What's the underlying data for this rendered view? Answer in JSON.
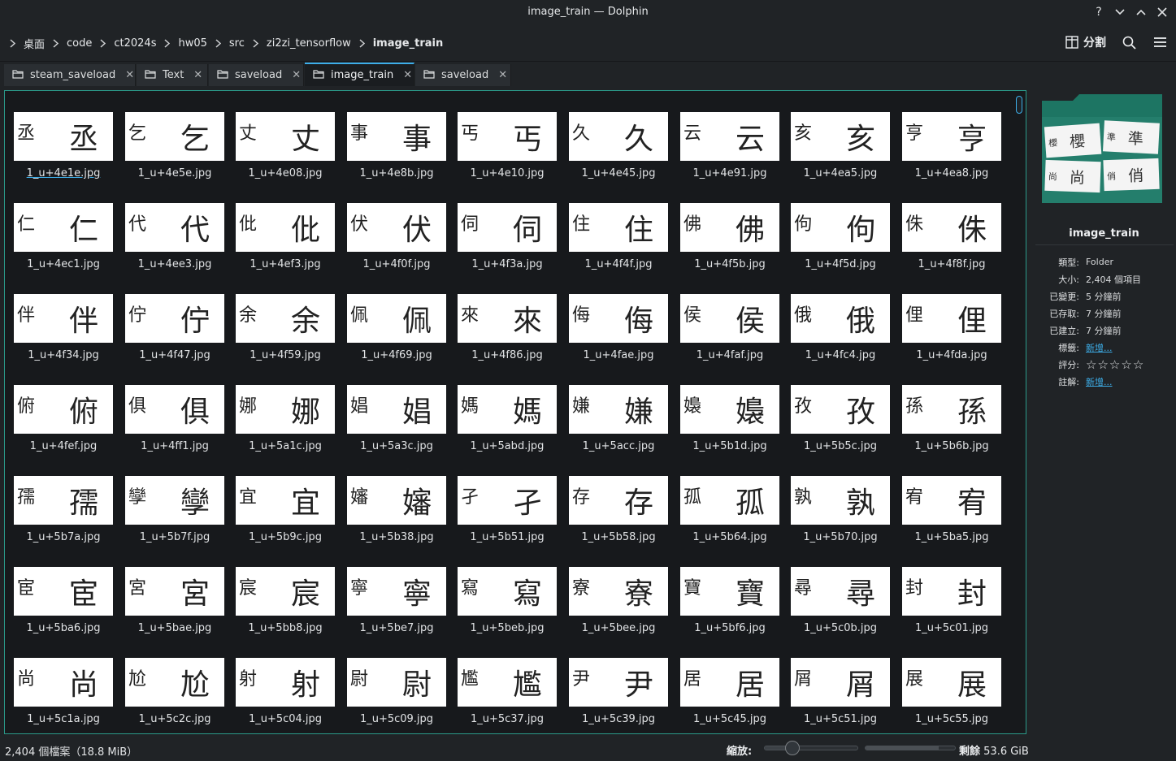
{
  "window": {
    "title": "image_train — Dolphin"
  },
  "toolbar": {
    "breadcrumbs": [
      "桌面",
      "code",
      "ct2024s",
      "hw05",
      "src",
      "zi2zi_tensorflow",
      "image_train"
    ],
    "split_label": "分割"
  },
  "tabs": [
    {
      "label": "steam_saveload"
    },
    {
      "label": "Text"
    },
    {
      "label": "saveload"
    },
    {
      "label": "image_train",
      "active": true
    },
    {
      "label": "saveload"
    }
  ],
  "files": [
    {
      "name": "1_u+4e1e.jpg",
      "char": "丞"
    },
    {
      "name": "1_u+4e5e.jpg",
      "char": "乞"
    },
    {
      "name": "1_u+4e08.jpg",
      "char": "丈"
    },
    {
      "name": "1_u+4e8b.jpg",
      "char": "事"
    },
    {
      "name": "1_u+4e10.jpg",
      "char": "丐"
    },
    {
      "name": "1_u+4e45.jpg",
      "char": "久"
    },
    {
      "name": "1_u+4e91.jpg",
      "char": "云"
    },
    {
      "name": "1_u+4ea5.jpg",
      "char": "亥"
    },
    {
      "name": "1_u+4ea8.jpg",
      "char": "亨"
    },
    {
      "name": "1_u+4ec1.jpg",
      "char": "仁"
    },
    {
      "name": "1_u+4ee3.jpg",
      "char": "代"
    },
    {
      "name": "1_u+4ef3.jpg",
      "char": "仳"
    },
    {
      "name": "1_u+4f0f.jpg",
      "char": "伏"
    },
    {
      "name": "1_u+4f3a.jpg",
      "char": "伺"
    },
    {
      "name": "1_u+4f4f.jpg",
      "char": "住"
    },
    {
      "name": "1_u+4f5b.jpg",
      "char": "佛"
    },
    {
      "name": "1_u+4f5d.jpg",
      "char": "佝"
    },
    {
      "name": "1_u+4f8f.jpg",
      "char": "侏"
    },
    {
      "name": "1_u+4f34.jpg",
      "char": "伴"
    },
    {
      "name": "1_u+4f47.jpg",
      "char": "佇"
    },
    {
      "name": "1_u+4f59.jpg",
      "char": "余"
    },
    {
      "name": "1_u+4f69.jpg",
      "char": "佩"
    },
    {
      "name": "1_u+4f86.jpg",
      "char": "來"
    },
    {
      "name": "1_u+4fae.jpg",
      "char": "侮"
    },
    {
      "name": "1_u+4faf.jpg",
      "char": "侯"
    },
    {
      "name": "1_u+4fc4.jpg",
      "char": "俄"
    },
    {
      "name": "1_u+4fda.jpg",
      "char": "俚"
    },
    {
      "name": "1_u+4fef.jpg",
      "char": "俯"
    },
    {
      "name": "1_u+4ff1.jpg",
      "char": "俱"
    },
    {
      "name": "1_u+5a1c.jpg",
      "char": "娜"
    },
    {
      "name": "1_u+5a3c.jpg",
      "char": "娼"
    },
    {
      "name": "1_u+5abd.jpg",
      "char": "媽"
    },
    {
      "name": "1_u+5acc.jpg",
      "char": "嫌"
    },
    {
      "name": "1_u+5b1d.jpg",
      "char": "嬝"
    },
    {
      "name": "1_u+5b5c.jpg",
      "char": "孜"
    },
    {
      "name": "1_u+5b6b.jpg",
      "char": "孫"
    },
    {
      "name": "1_u+5b7a.jpg",
      "char": "孺"
    },
    {
      "name": "1_u+5b7f.jpg",
      "char": "孿"
    },
    {
      "name": "1_u+5b9c.jpg",
      "char": "宜"
    },
    {
      "name": "1_u+5b38.jpg",
      "char": "嬸"
    },
    {
      "name": "1_u+5b51.jpg",
      "char": "孑"
    },
    {
      "name": "1_u+5b58.jpg",
      "char": "存"
    },
    {
      "name": "1_u+5b64.jpg",
      "char": "孤"
    },
    {
      "name": "1_u+5b70.jpg",
      "char": "孰"
    },
    {
      "name": "1_u+5ba5.jpg",
      "char": "宥"
    },
    {
      "name": "1_u+5ba6.jpg",
      "char": "宦"
    },
    {
      "name": "1_u+5bae.jpg",
      "char": "宮"
    },
    {
      "name": "1_u+5bb8.jpg",
      "char": "宸"
    },
    {
      "name": "1_u+5be7.jpg",
      "char": "寧"
    },
    {
      "name": "1_u+5beb.jpg",
      "char": "寫"
    },
    {
      "name": "1_u+5bee.jpg",
      "char": "寮"
    },
    {
      "name": "1_u+5bf6.jpg",
      "char": "寶"
    },
    {
      "name": "1_u+5c0b.jpg",
      "char": "尋"
    },
    {
      "name": "1_u+5c01.jpg",
      "char": "封"
    },
    {
      "name": "1_u+5c1a.jpg",
      "char": "尚"
    },
    {
      "name": "1_u+5c2c.jpg",
      "char": "尬"
    },
    {
      "name": "1_u+5c04.jpg",
      "char": "射"
    },
    {
      "name": "1_u+5c09.jpg",
      "char": "尉"
    },
    {
      "name": "1_u+5c37.jpg",
      "char": "尷"
    },
    {
      "name": "1_u+5c39.jpg",
      "char": "尹"
    },
    {
      "name": "1_u+5c45.jpg",
      "char": "居"
    },
    {
      "name": "1_u+5c51.jpg",
      "char": "屑"
    },
    {
      "name": "1_u+5c55.jpg",
      "char": "展"
    }
  ],
  "panel": {
    "preview_chars": [
      "櫻",
      "準",
      "尚",
      "俏"
    ],
    "title": "image_train",
    "meta": [
      {
        "key": "類型:",
        "value": "Folder"
      },
      {
        "key": "大小:",
        "value": "2,404 個項目"
      },
      {
        "key": "已變更:",
        "value": "5 分鐘前"
      },
      {
        "key": "已存取:",
        "value": "7 分鐘前"
      },
      {
        "key": "已建立:",
        "value": "7 分鐘前"
      },
      {
        "key": "標籤:",
        "value": "新增...",
        "link": true
      },
      {
        "key": "評分:",
        "value": "",
        "rating": 0
      },
      {
        "key": "註解:",
        "value": "新增...",
        "link": true
      }
    ]
  },
  "status": {
    "file_count": "2,404 個檔案（18.8 MiB）",
    "zoom_label": "縮放:",
    "zoom_level": 0.3,
    "free_label": "剩餘",
    "free_value": "53.6 GiB",
    "disk_used_fraction": 0.82
  },
  "colors": {
    "accent": "#3daee9",
    "frame": "#2b9a8a",
    "folder_preview": "#1d7563"
  }
}
